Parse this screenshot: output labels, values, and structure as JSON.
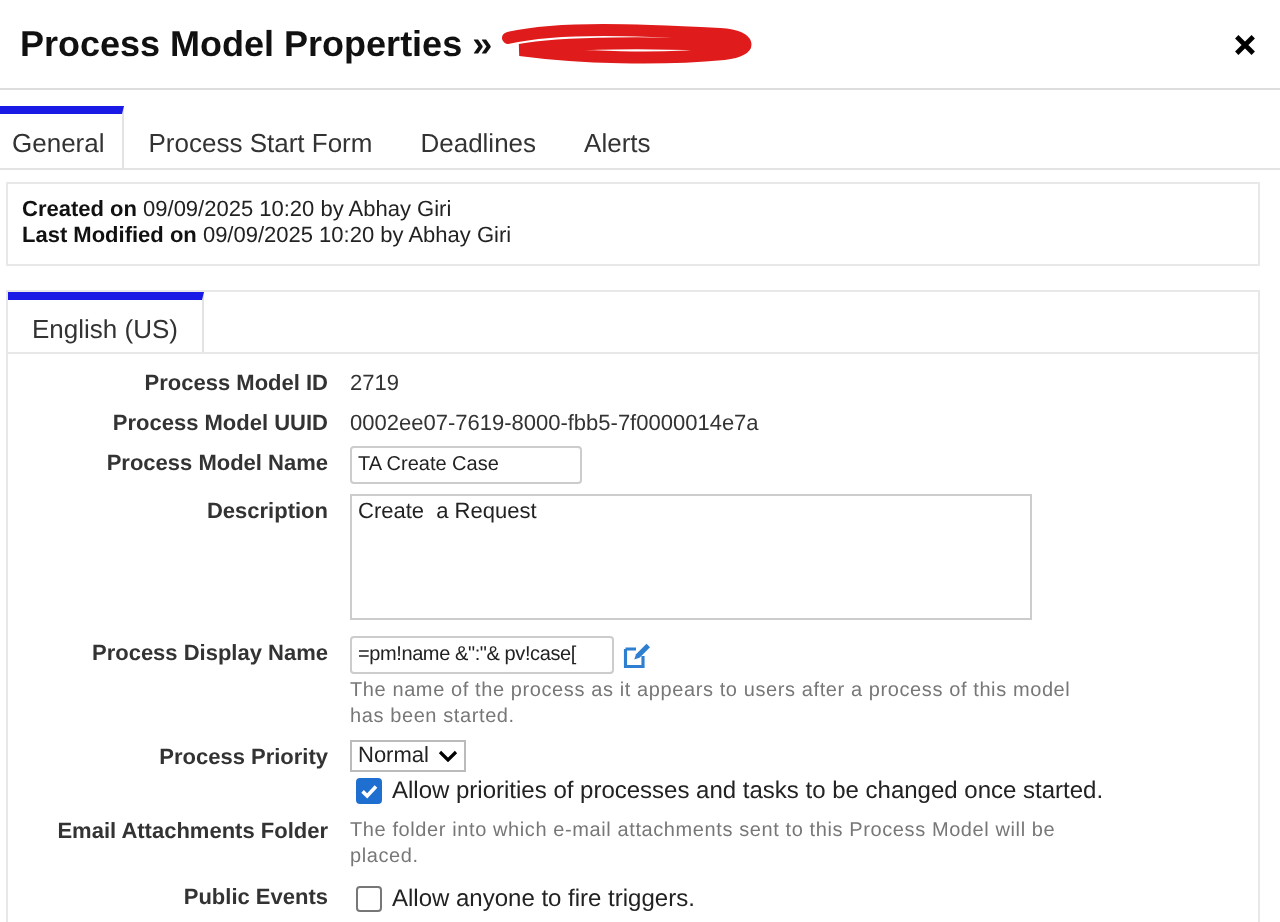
{
  "window": {
    "title": "Process Model Properties »",
    "title_redacted": true
  },
  "tabs": [
    {
      "label": "General",
      "selected": true
    },
    {
      "label": "Process Start Form",
      "selected": false
    },
    {
      "label": "Deadlines",
      "selected": false
    },
    {
      "label": "Alerts",
      "selected": false
    }
  ],
  "info": [
    {
      "label": "Created on",
      "value": "09/09/2025 10:20 by Abhay Giri"
    },
    {
      "label": "Last Modified on",
      "value": "09/09/2025 10:20 by Abhay Giri"
    }
  ],
  "language_tabs": [
    {
      "label": "English (US)",
      "selected": true
    }
  ],
  "fields": [
    {
      "kind": "text",
      "label": "Process Model ID",
      "value": "2719"
    },
    {
      "kind": "text",
      "label": "Process Model UUID",
      "value": "0002ee07-7619-8000-fbb5-7f0000014e7a"
    },
    {
      "kind": "input",
      "label": "Process Model Name",
      "value": "TA Create Case"
    },
    {
      "kind": "textarea",
      "label": "Description",
      "value": "Create  a Request"
    },
    {
      "kind": "expression",
      "label": "Process Display Name",
      "value": "=pm!name &\":\"& pv!case[",
      "hint": "The name of the process as it appears to users after a process of this model has been started."
    },
    {
      "kind": "select",
      "label": "Process Priority",
      "value": "Normal",
      "checkbox": {
        "label": "Allow priorities of processes and tasks to be changed once started.",
        "checked": true
      }
    },
    {
      "kind": "note",
      "label": "Email Attachments Folder",
      "hint": "The folder into which e-mail attachments sent to this Process Model will be placed."
    },
    {
      "kind": "checkbox",
      "label": "Public Events",
      "checkbox": {
        "label": "Allow anyone to fire triggers.",
        "checked": false
      }
    }
  ]
}
